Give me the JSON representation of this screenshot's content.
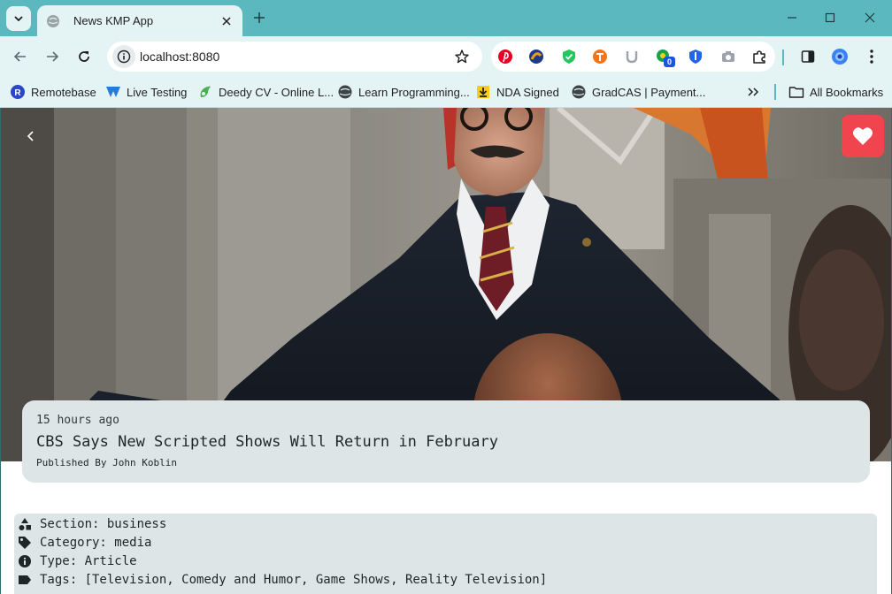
{
  "browser": {
    "tab_title": "News KMP App",
    "url": "localhost:8080",
    "extension_badge": "0",
    "accent": "#5bb8bf"
  },
  "bookmarks": [
    {
      "label": "Remotebase",
      "icon": "remotebase-icon"
    },
    {
      "label": "Live Testing",
      "icon": "live-testing-icon"
    },
    {
      "label": "Deedy CV - Online L...",
      "icon": "overleaf-icon"
    },
    {
      "label": "Learn Programming...",
      "icon": "globe-icon"
    },
    {
      "label": "NDA Signed",
      "icon": "download-icon"
    },
    {
      "label": "GradCAS | Payment...",
      "icon": "globe-icon"
    }
  ],
  "all_bookmarks_label": "All Bookmarks",
  "article": {
    "time_ago": "15 hours ago",
    "title": "CBS Says New Scripted Shows Will Return in February",
    "byline": "Published By John Koblin"
  },
  "meta": {
    "section": "Section: business",
    "category": "Category: media",
    "type": "Type: Article",
    "tags": "Tags: [Television, Comedy and Humor, Game Shows, Reality Television]"
  },
  "colors": {
    "favorite_button": "#f0454f",
    "card_background": "#dde5e7"
  }
}
